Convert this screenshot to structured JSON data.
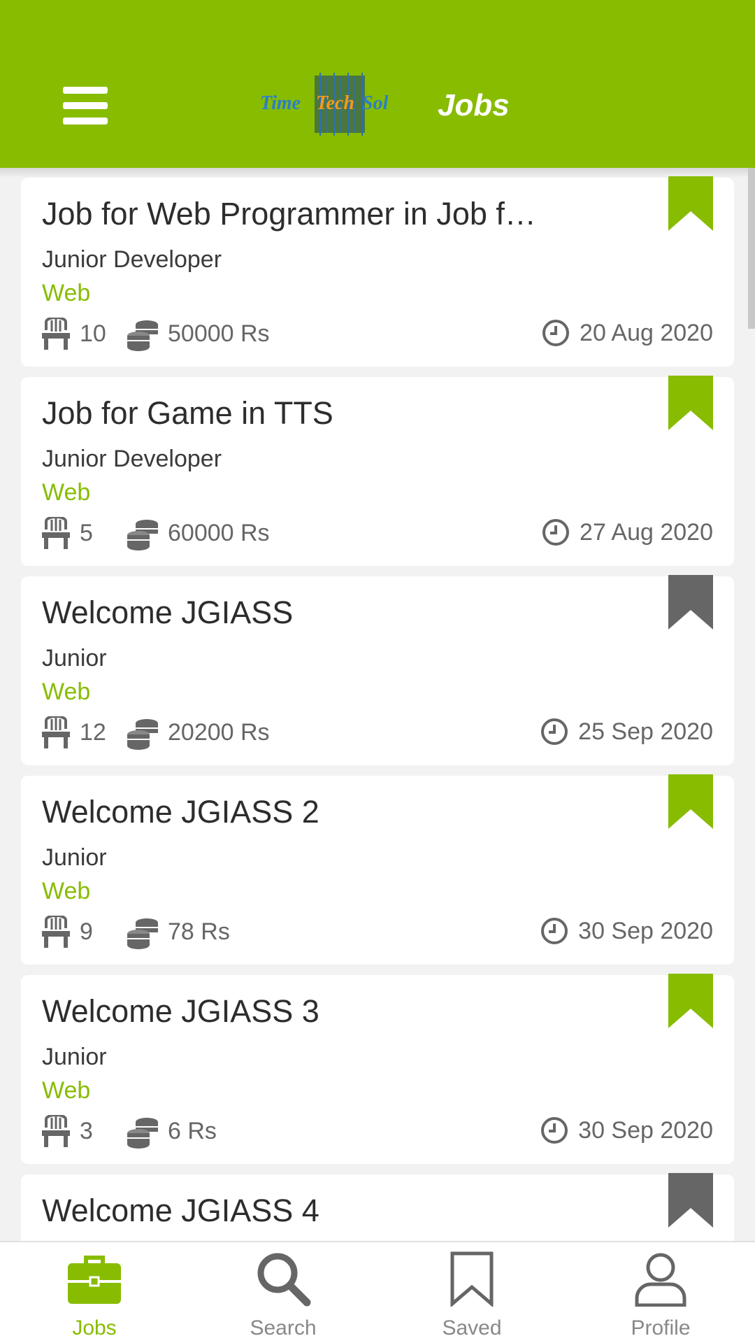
{
  "app_bar": {
    "title": "Jobs",
    "logo_text": "TimeTechSol",
    "menu_icon": "menu-icon",
    "bg_color": "#88bc00"
  },
  "colors": {
    "accent": "#88bc00",
    "bookmark_inactive": "#666666",
    "text_primary": "#2d2d2d",
    "text_secondary": "#666666"
  },
  "jobs": [
    {
      "title": "Job for Web Programmer in Job f…",
      "level": "Junior Developer",
      "category": "Web",
      "seats": "10",
      "salary": "50000 Rs",
      "date": "20 Aug 2020",
      "saved": true
    },
    {
      "title": "Job for Game in TTS",
      "level": "Junior Developer",
      "category": "Web",
      "seats": "5",
      "salary": "60000 Rs",
      "date": "27 Aug 2020",
      "saved": true
    },
    {
      "title": "Welcome JGIASS",
      "level": "Junior",
      "category": "Web",
      "seats": "12",
      "salary": "20200 Rs",
      "date": "25 Sep 2020",
      "saved": false
    },
    {
      "title": "Welcome JGIASS 2",
      "level": "Junior",
      "category": "Web",
      "seats": "9",
      "salary": "78 Rs",
      "date": "30 Sep 2020",
      "saved": true
    },
    {
      "title": "Welcome JGIASS 3",
      "level": "Junior",
      "category": "Web",
      "seats": "3",
      "salary": "6 Rs",
      "date": "30 Sep 2020",
      "saved": true
    },
    {
      "title": "Welcome JGIASS 4",
      "level": "",
      "category": "",
      "seats": "",
      "salary": "",
      "date": "",
      "saved": false
    }
  ],
  "bottom_nav": [
    {
      "label": "Jobs",
      "icon": "briefcase-icon",
      "active": true
    },
    {
      "label": "Search",
      "icon": "search-icon",
      "active": false
    },
    {
      "label": "Saved",
      "icon": "bookmark-icon",
      "active": false
    },
    {
      "label": "Profile",
      "icon": "profile-icon",
      "active": false
    }
  ]
}
